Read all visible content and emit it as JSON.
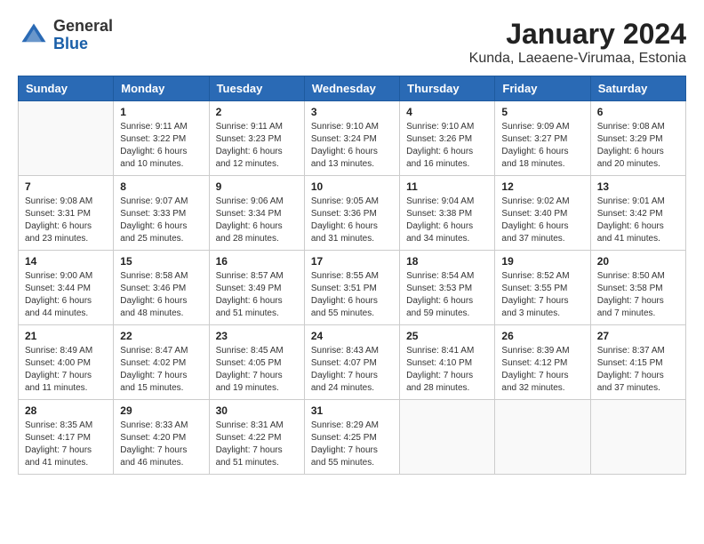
{
  "header": {
    "logo_general": "General",
    "logo_blue": "Blue",
    "title": "January 2024",
    "subtitle": "Kunda, Laeaene-Virumaa, Estonia"
  },
  "weekdays": [
    "Sunday",
    "Monday",
    "Tuesday",
    "Wednesday",
    "Thursday",
    "Friday",
    "Saturday"
  ],
  "weeks": [
    [
      {
        "day": "",
        "info": ""
      },
      {
        "day": "1",
        "info": "Sunrise: 9:11 AM\nSunset: 3:22 PM\nDaylight: 6 hours\nand 10 minutes."
      },
      {
        "day": "2",
        "info": "Sunrise: 9:11 AM\nSunset: 3:23 PM\nDaylight: 6 hours\nand 12 minutes."
      },
      {
        "day": "3",
        "info": "Sunrise: 9:10 AM\nSunset: 3:24 PM\nDaylight: 6 hours\nand 13 minutes."
      },
      {
        "day": "4",
        "info": "Sunrise: 9:10 AM\nSunset: 3:26 PM\nDaylight: 6 hours\nand 16 minutes."
      },
      {
        "day": "5",
        "info": "Sunrise: 9:09 AM\nSunset: 3:27 PM\nDaylight: 6 hours\nand 18 minutes."
      },
      {
        "day": "6",
        "info": "Sunrise: 9:08 AM\nSunset: 3:29 PM\nDaylight: 6 hours\nand 20 minutes."
      }
    ],
    [
      {
        "day": "7",
        "info": "Sunrise: 9:08 AM\nSunset: 3:31 PM\nDaylight: 6 hours\nand 23 minutes."
      },
      {
        "day": "8",
        "info": "Sunrise: 9:07 AM\nSunset: 3:33 PM\nDaylight: 6 hours\nand 25 minutes."
      },
      {
        "day": "9",
        "info": "Sunrise: 9:06 AM\nSunset: 3:34 PM\nDaylight: 6 hours\nand 28 minutes."
      },
      {
        "day": "10",
        "info": "Sunrise: 9:05 AM\nSunset: 3:36 PM\nDaylight: 6 hours\nand 31 minutes."
      },
      {
        "day": "11",
        "info": "Sunrise: 9:04 AM\nSunset: 3:38 PM\nDaylight: 6 hours\nand 34 minutes."
      },
      {
        "day": "12",
        "info": "Sunrise: 9:02 AM\nSunset: 3:40 PM\nDaylight: 6 hours\nand 37 minutes."
      },
      {
        "day": "13",
        "info": "Sunrise: 9:01 AM\nSunset: 3:42 PM\nDaylight: 6 hours\nand 41 minutes."
      }
    ],
    [
      {
        "day": "14",
        "info": "Sunrise: 9:00 AM\nSunset: 3:44 PM\nDaylight: 6 hours\nand 44 minutes."
      },
      {
        "day": "15",
        "info": "Sunrise: 8:58 AM\nSunset: 3:46 PM\nDaylight: 6 hours\nand 48 minutes."
      },
      {
        "day": "16",
        "info": "Sunrise: 8:57 AM\nSunset: 3:49 PM\nDaylight: 6 hours\nand 51 minutes."
      },
      {
        "day": "17",
        "info": "Sunrise: 8:55 AM\nSunset: 3:51 PM\nDaylight: 6 hours\nand 55 minutes."
      },
      {
        "day": "18",
        "info": "Sunrise: 8:54 AM\nSunset: 3:53 PM\nDaylight: 6 hours\nand 59 minutes."
      },
      {
        "day": "19",
        "info": "Sunrise: 8:52 AM\nSunset: 3:55 PM\nDaylight: 7 hours\nand 3 minutes."
      },
      {
        "day": "20",
        "info": "Sunrise: 8:50 AM\nSunset: 3:58 PM\nDaylight: 7 hours\nand 7 minutes."
      }
    ],
    [
      {
        "day": "21",
        "info": "Sunrise: 8:49 AM\nSunset: 4:00 PM\nDaylight: 7 hours\nand 11 minutes."
      },
      {
        "day": "22",
        "info": "Sunrise: 8:47 AM\nSunset: 4:02 PM\nDaylight: 7 hours\nand 15 minutes."
      },
      {
        "day": "23",
        "info": "Sunrise: 8:45 AM\nSunset: 4:05 PM\nDaylight: 7 hours\nand 19 minutes."
      },
      {
        "day": "24",
        "info": "Sunrise: 8:43 AM\nSunset: 4:07 PM\nDaylight: 7 hours\nand 24 minutes."
      },
      {
        "day": "25",
        "info": "Sunrise: 8:41 AM\nSunset: 4:10 PM\nDaylight: 7 hours\nand 28 minutes."
      },
      {
        "day": "26",
        "info": "Sunrise: 8:39 AM\nSunset: 4:12 PM\nDaylight: 7 hours\nand 32 minutes."
      },
      {
        "day": "27",
        "info": "Sunrise: 8:37 AM\nSunset: 4:15 PM\nDaylight: 7 hours\nand 37 minutes."
      }
    ],
    [
      {
        "day": "28",
        "info": "Sunrise: 8:35 AM\nSunset: 4:17 PM\nDaylight: 7 hours\nand 41 minutes."
      },
      {
        "day": "29",
        "info": "Sunrise: 8:33 AM\nSunset: 4:20 PM\nDaylight: 7 hours\nand 46 minutes."
      },
      {
        "day": "30",
        "info": "Sunrise: 8:31 AM\nSunset: 4:22 PM\nDaylight: 7 hours\nand 51 minutes."
      },
      {
        "day": "31",
        "info": "Sunrise: 8:29 AM\nSunset: 4:25 PM\nDaylight: 7 hours\nand 55 minutes."
      },
      {
        "day": "",
        "info": ""
      },
      {
        "day": "",
        "info": ""
      },
      {
        "day": "",
        "info": ""
      }
    ]
  ]
}
